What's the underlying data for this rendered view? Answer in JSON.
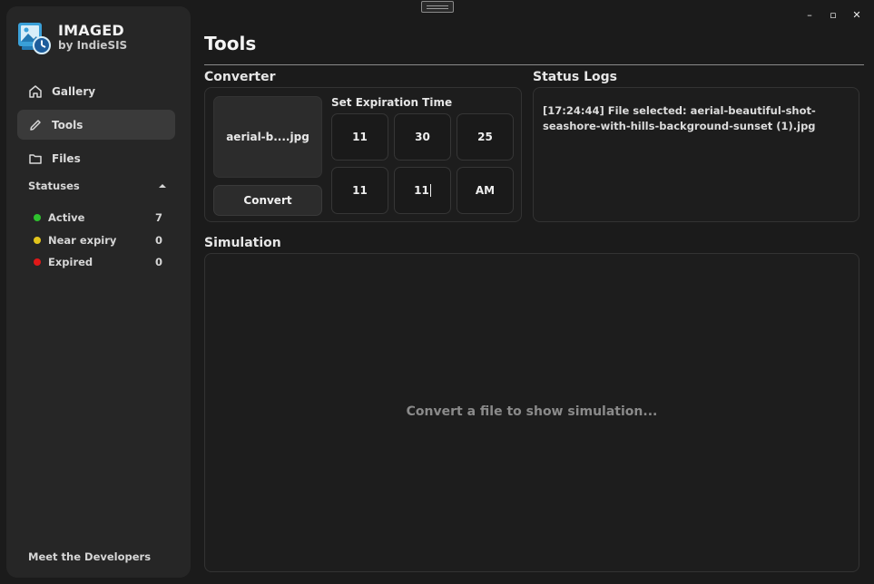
{
  "app": {
    "name": "IMAGED",
    "byline": "by IndieSIS"
  },
  "window_controls": {
    "minimize": "–",
    "maximize": "▫",
    "close": "✕"
  },
  "sidebar": {
    "items": [
      {
        "label": "Gallery",
        "icon": "home-icon",
        "active": false
      },
      {
        "label": "Tools",
        "icon": "pencil-icon",
        "active": true
      },
      {
        "label": "Files",
        "icon": "folder-icon",
        "active": false
      }
    ],
    "statuses_label": "Statuses",
    "statuses": [
      {
        "label": "Active",
        "count": "7",
        "color": "#2ec22e"
      },
      {
        "label": "Near expiry",
        "count": "0",
        "color": "#e2c41c"
      },
      {
        "label": "Expired",
        "count": "0",
        "color": "#e01818"
      }
    ],
    "footer_link": "Meet the Developers"
  },
  "main": {
    "title": "Tools",
    "converter": {
      "label": "Converter",
      "file_name": "aerial-b....jpg",
      "convert_label": "Convert",
      "expiration_label": "Set Expiration Time",
      "fields": [
        "11",
        "30",
        "25",
        "11",
        "11",
        "AM"
      ]
    },
    "logs": {
      "label": "Status Logs",
      "entries": [
        "[17:24:44] File selected: aerial-beautiful-shot-seashore-with-hills-background-sunset (1).jpg"
      ]
    },
    "simulation": {
      "label": "Simulation",
      "placeholder": "Convert a file to show simulation..."
    }
  }
}
